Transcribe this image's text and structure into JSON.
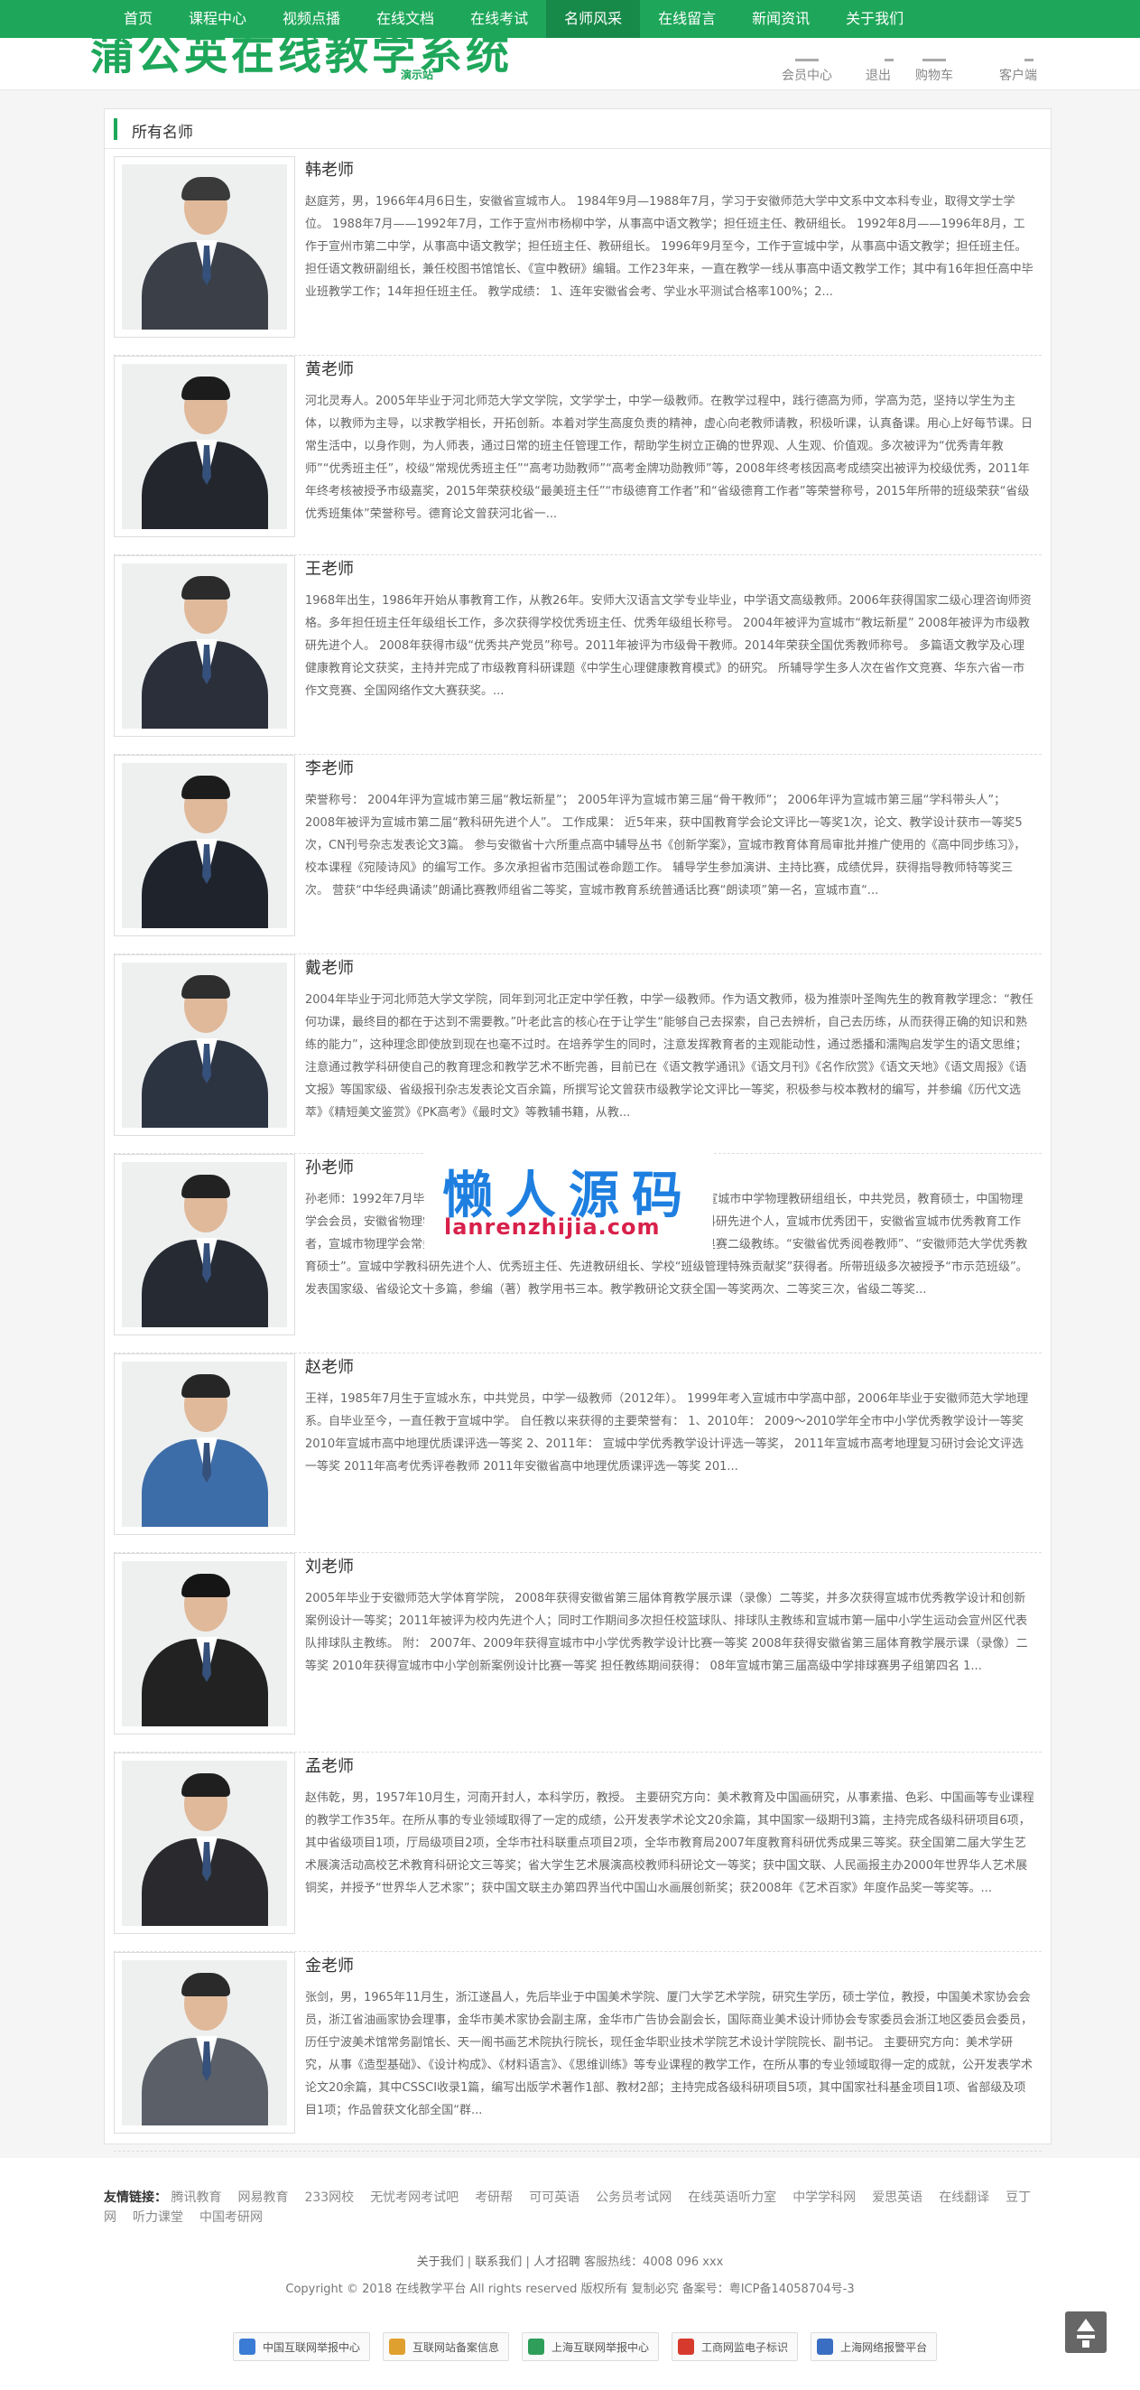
{
  "nav": {
    "items": [
      "首页",
      "课程中心",
      "视频点播",
      "在线文档",
      "在线考试",
      "名师风采",
      "在线留言",
      "新闻资讯",
      "关于我们"
    ],
    "active_index": 5
  },
  "header": {
    "logo_text": "蒲公英在线教学系统",
    "logo_sub": "演示站",
    "links": [
      "会员中心",
      "退出",
      "购物车",
      "客户端"
    ]
  },
  "section": {
    "title": "所有名师"
  },
  "teachers": [
    {
      "name": "韩老师",
      "desc": "赵庭芳，男，1966年4月6日生，安徽省宣城市人。 1984年9月—1988年7月，学习于安徽师范大学中文系中文本科专业，取得文学士学位。 1988年7月——1992年7月，工作于宣州市杨柳中学，从事高中语文教学；担任班主任、教研组长。 1992年8月——1996年8月，工作于宣州市第二中学，从事高中语文教学；担任班主任、教研组长。 1996年9月至今，工作于宣城中学，从事高中语文教学；担任班主任。担任语文教研副组长，兼任校图书馆馆长、《宣中教研》编辑。工作23年来，一直在教学一线从事高中语文教学工作；其中有16年担任高中毕业班教学工作；14年担任班主任。 教学成绩： 1、连年安徽省会考、学业水平测试合格率100%；2..."
    },
    {
      "name": "黄老师",
      "desc": "河北灵寿人。2005年毕业于河北师范大学文学院，文学学士，中学一级教师。在教学过程中，践行德高为师，学高为范，坚持以学生为主体，以教师为主导，以求教学相长，开拓创新。本着对学生高度负责的精神，虚心向老教师请教，积极听课，认真备课。用心上好每节课。日常生活中，以身作则，为人师表，通过日常的班主任管理工作，帮助学生树立正确的世界观、人生观、价值观。多次被评为“优秀青年教师”“优秀班主任”，校级“常规优秀班主任”“高考功勋教师”“高考金牌功勋教师”等，2008年终考核因高考成绩突出被评为校级优秀，2011年年终考核被授予市级嘉奖，2015年荣获校级“最美班主任”“市级德育工作者”和“省级德育工作者”等荣誉称号，2015年所带的班级荣获“省级优秀班集体”荣誉称号。德育论文曾获河北省一..."
    },
    {
      "name": "王老师",
      "desc": "1968年出生，1986年开始从事教育工作，从教26年。安师大汉语言文学专业毕业，中学语文高级教师。2006年获得国家二级心理咨询师资格。多年担任班主任年级组长工作，多次获得学校优秀班主任、优秀年级组长称号。 2004年被评为宣城市“教坛新星” 2008年被评为市级教研先进个人。 2008年获得市级“优秀共产党员”称号。2011年被评为市级骨干教师。2014年荣获全国优秀教师称号。 多篇语文教学及心理健康教育论文获奖，主持并完成了市级教育科研课题《中学生心理健康教育模式》的研究。 所辅导学生多人次在省作文竞赛、华东六省一市作文竞赛、全国网络作文大赛获奖。..."
    },
    {
      "name": "李老师",
      "desc": "荣誉称号： 2004年评为宣城市第三届“教坛新星”； 2005年评为宣城市第三届“骨干教师”； 2006年评为宣城市第三届“学科带头人”； 2008年被评为宣城市第二届“教科研先进个人”。 工作成果： 近5年来，获中国教育学会论文评比一等奖1次，论文、教学设计获市一等奖5次，CN刊号杂志发表论文3篇。 参与安徽省十六所重点高中辅导丛书《创新学案》，宣城市教育体育局审批并推广使用的《高中同步练习》，校本课程《宛陵诗风》的编写工作。多次承担省市范围试卷命题工作。 辅导学生参加演讲、主持比赛，成绩优异，获得指导教师特等奖三次。 营获“中华经典诵读”朗诵比赛教师组省二等奖，宣城市教育系统普通话比赛“朗读项”第一名，宣城市直“..."
    },
    {
      "name": "戴老师",
      "desc": "2004年毕业于河北师范大学文学院，同年到河北正定中学任教，中学一级教师。作为语文教师，极为推崇叶圣陶先生的教育教学理念：“教任何功课，最终目的都在于达到不需要教。”叶老此言的核心在于让学生“能够自己去探索，自己去辨析，自己去历练，从而获得正确的知识和熟练的能力”，这种理念即使放到现在也毫不过时。在培养学生的同时，注意发挥教育者的主观能动性，通过悉播和濡陶启发学生的语文思维；注意通过教学科研使自己的教育理念和教学艺术不断完善，目前已在《语文教学通讯》《语文月刊》《名作欣赏》《语文天地》《语文周报》《语文报》等国家级、省级报刊杂志发表论文百余篇，所撰写论文曾获市级教学论文评比一等奖，积极参与校本教材的编写，并参编《历代文选萃》《精短美文鉴赏》《PK高考》《最时文》等教辅书籍，从教..."
    },
    {
      "name": "孙老师",
      "desc": "孙老师：1992年7月毕业于安徽师范大学物理系，同年参加工作至今。安徽省宣城市中学物理教研组组长，中共党员，教育硕士，中国物理学会会员，安徽省物理学会会员，宣城市教坛新星，青年骨干教师，宣城市教科研先进个人，宣城市优秀团干，安徽省宣城市优秀教育工作者，宣城市物理学会常务理事及副秘书长，常务理事、理事，安徽省高中物理奥赛二级教练。“安徽省优秀阅卷教师”、“安徽师范大学优秀教育硕士”。宣城中学教科研先进个人、优秀班主任、先进教研组长、学校“班级管理特殊贡献奖”获得者。所带班级多次被授予“市示范班级”。发表国家级、省级论文十多篇，参编（著）教学用书三本。教学教研论文获全国一等奖两次、二等奖三次，省级二等奖..."
    },
    {
      "name": "赵老师",
      "desc": "王祥，1985年7月生于宣城水东，中共党员，中学一级教师（2012年）。 1999年考入宣城市中学高中部，2006年毕业于安徽师范大学地理系。自毕业至今，一直任教于宣城中学。 自任教以来获得的主要荣誉有： 1、2010年： 2009～2010学年全市中小学优秀教学设计一等奖 2010年宣城市高中地理优质课评选一等奖 2、2011年： 宣城中学优秀教学设计评选一等奖， 2011年宣城市高考地理复习研讨会论文评选一等奖 2011年高考优秀评卷教师 2011年安徽省高中地理优质课评选一等奖 201..."
    },
    {
      "name": "刘老师",
      "desc": "2005年毕业于安徽师范大学体育学院， 2008年获得安徽省第三届体育教学展示课（录像）二等奖，并多次获得宣城市优秀教学设计和创新案例设计一等奖；2011年被评为校内先进个人；同时工作期间多次担任校篮球队、排球队主教练和宣城市第一届中小学生运动会宣州区代表队排球队主教练。 附： 2007年、2009年获得宣城市中小学优秀教学设计比赛一等奖 2008年获得安徽省第三届体育教学展示课（录像）二等奖 2010年获得宣城市中小学创新案例设计比赛一等奖 担任教练期间获得： 08年宣城市第三届高级中学排球赛男子组第四名 1..."
    },
    {
      "name": "孟老师",
      "desc": "赵伟乾，男，1957年10月生，河南开封人，本科学历，教授。 主要研究方向：美术教育及中国画研究，从事素描、色彩、中国画等专业课程的教学工作35年。在所从事的专业领域取得了一定的成绩，公开发表学术论文20余篇，其中国家一级期刊3篇，主持完成各级科研项目6项，其中省级项目1项，厅局级项目2项，全华市社科联重点项目2项，全华市教育局2007年度教育科研优秀成果三等奖。获全国第二届大学生艺术展演活动高校艺术教育科研论文三等奖；省大学生艺术展演高校教师科研论文一等奖；获中国文联、人民画报主办2000年世界华人艺术展铜奖，并授予“世界华人艺术家”；获中国文联主办第四界当代中国山水画展创新奖；获2008年《艺术百家》年度作品奖一等奖等。..."
    },
    {
      "name": "金老师",
      "desc": "张剑，男，1965年11月生，浙江遂昌人，先后毕业于中国美术学院、厦门大学艺术学院，研究生学历，硕士学位，教授，中国美术家协会会员，浙江省油画家协会理事，金华市美术家协会副主席，金华市广告协会副会长，国际商业美术设计师协会专家委员会浙江地区委员会委员，历任宁波美术馆常务副馆长、天一阁书画艺术院执行院长，现任金华职业技术学院艺术设计学院院长、副书记。 主要研究方向：美术学研究，从事《造型基础》、《设计构成》、《材料语言》、《思维训练》等专业课程的教学工作，在所从事的专业领域取得一定的成就，公开发表学术论文20余篇，其中CSSCI收录1篇，编写出版学术著作1部、教材2部；主持完成各级科研项目5项，其中国家社科基金项目1项、省部级及项目1项；作品曾获文化部全国“群..."
    }
  ],
  "watermark": {
    "cn": "懒人源码",
    "en": "lanrenzhijia.com"
  },
  "friend_links": {
    "label": "友情链接：",
    "items": [
      "腾讯教育",
      "网易教育",
      "233网校",
      "无忧考网考试吧",
      "考研帮",
      "可可英语",
      "公务员考试网",
      "在线英语听力室",
      "中学学科网",
      "爱思英语",
      "在线翻译",
      "豆丁网",
      "听力课堂",
      "中国考研网"
    ]
  },
  "footer": {
    "links": [
      "关于我们",
      "联系我们",
      "人才招聘"
    ],
    "hotline": "客服热线：4008 096 xxx",
    "copyright": "Copyright © 2018 在线教学平台 All rights reserved 版权所有 复制必究 备案号：粤ICP备14058704号-3",
    "badges": [
      {
        "label": "中国互联网举报中心",
        "color": "#3a7bd5"
      },
      {
        "label": "互联网站备案信息",
        "color": "#e0a030"
      },
      {
        "label": "上海互联网举报中心",
        "color": "#2e9e5a"
      },
      {
        "label": "工商网监电子标识",
        "color": "#d63a2c"
      },
      {
        "label": "上海网络报警平台",
        "color": "#3a6ec2"
      }
    ]
  }
}
